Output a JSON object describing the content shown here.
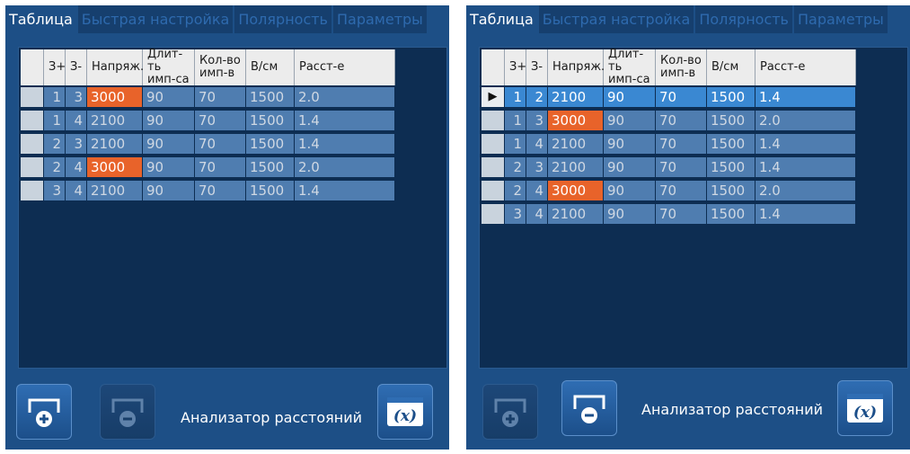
{
  "tabs": [
    "Таблица",
    "Быстрая настройка",
    "Полярность",
    "Параметры"
  ],
  "headers": [
    "",
    "З+",
    "З-",
    "Напряж.",
    "Длит-ть\nимп-са",
    "Кол-во\nимп-в",
    "В/см",
    "Расст-е"
  ],
  "colors": {
    "panel": "#1d4f86",
    "table_bg": "#0d2d52",
    "row": "#4f7db0",
    "active_row": "#3a88d2",
    "highlight": "#e8632a"
  },
  "left_panel": {
    "rows": [
      {
        "zp": "1",
        "zm": "3",
        "voltage": "3000",
        "duration": "90",
        "count": "70",
        "vcm": "1500",
        "dist": "2.0",
        "highlight": true
      },
      {
        "zp": "1",
        "zm": "4",
        "voltage": "2100",
        "duration": "90",
        "count": "70",
        "vcm": "1500",
        "dist": "1.4",
        "highlight": false
      },
      {
        "zp": "2",
        "zm": "3",
        "voltage": "2100",
        "duration": "90",
        "count": "70",
        "vcm": "1500",
        "dist": "1.4",
        "highlight": false
      },
      {
        "zp": "2",
        "zm": "4",
        "voltage": "3000",
        "duration": "90",
        "count": "70",
        "vcm": "1500",
        "dist": "2.0",
        "highlight": true
      },
      {
        "zp": "3",
        "zm": "4",
        "voltage": "2100",
        "duration": "90",
        "count": "70",
        "vcm": "1500",
        "dist": "1.4",
        "highlight": false
      }
    ],
    "analyzer_label": "Анализатор расстояний",
    "add_enabled": true,
    "remove_enabled": false
  },
  "right_panel": {
    "rows": [
      {
        "marker": "▶",
        "zp": "1",
        "zm": "2",
        "voltage": "2100",
        "duration": "90",
        "count": "70",
        "vcm": "1500",
        "dist": "1.4",
        "highlight": false,
        "active": true
      },
      {
        "marker": "",
        "zp": "1",
        "zm": "3",
        "voltage": "3000",
        "duration": "90",
        "count": "70",
        "vcm": "1500",
        "dist": "2.0",
        "highlight": true,
        "active": false
      },
      {
        "marker": "",
        "zp": "1",
        "zm": "4",
        "voltage": "2100",
        "duration": "90",
        "count": "70",
        "vcm": "1500",
        "dist": "1.4",
        "highlight": false,
        "active": false
      },
      {
        "marker": "",
        "zp": "2",
        "zm": "3",
        "voltage": "2100",
        "duration": "90",
        "count": "70",
        "vcm": "1500",
        "dist": "1.4",
        "highlight": false,
        "active": false
      },
      {
        "marker": "",
        "zp": "2",
        "zm": "4",
        "voltage": "3000",
        "duration": "90",
        "count": "70",
        "vcm": "1500",
        "dist": "2.0",
        "highlight": true,
        "active": false
      },
      {
        "marker": "",
        "zp": "3",
        "zm": "4",
        "voltage": "2100",
        "duration": "90",
        "count": "70",
        "vcm": "1500",
        "dist": "1.4",
        "highlight": false,
        "active": false
      }
    ],
    "analyzer_label": "Анализатор расстояний",
    "add_enabled": false,
    "remove_enabled": true
  }
}
